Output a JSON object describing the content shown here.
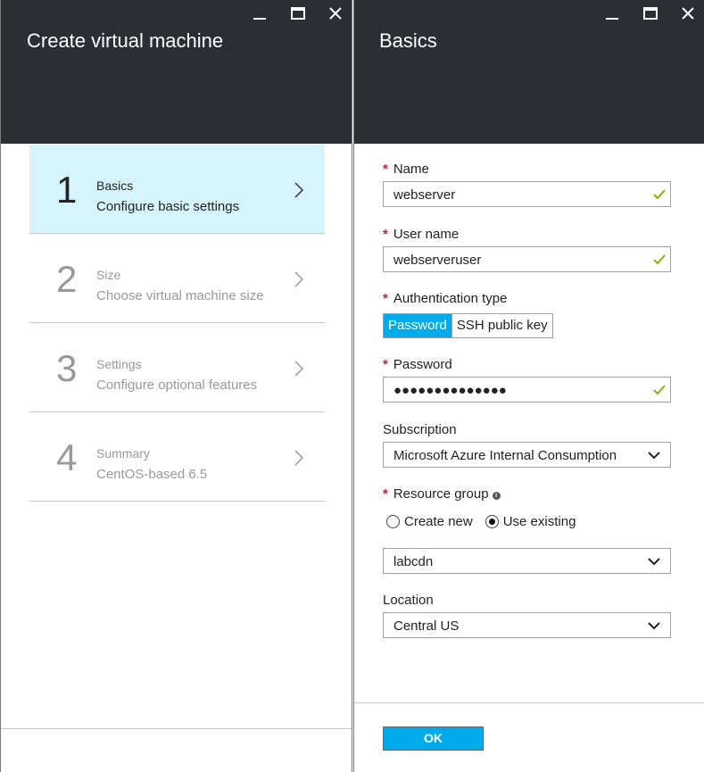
{
  "left_blade": {
    "title": "Create virtual machine",
    "steps": [
      {
        "number": "1",
        "title": "Basics",
        "subtitle": "Configure basic settings",
        "active": true
      },
      {
        "number": "2",
        "title": "Size",
        "subtitle": "Choose virtual machine size",
        "active": false
      },
      {
        "number": "3",
        "title": "Settings",
        "subtitle": "Configure optional features",
        "active": false
      },
      {
        "number": "4",
        "title": "Summary",
        "subtitle": "CentOS-based 6.5",
        "active": false
      }
    ]
  },
  "right_blade": {
    "title": "Basics",
    "required_marker": "*",
    "name": {
      "label": "Name",
      "value": "webserver"
    },
    "user_name": {
      "label": "User name",
      "value": "webserveruser"
    },
    "auth_type": {
      "label": "Authentication type",
      "options": [
        "Password",
        "SSH public key"
      ],
      "selected": "Password"
    },
    "password": {
      "label": "Password",
      "value": "●●●●●●●●●●●●●●"
    },
    "subscription": {
      "label": "Subscription",
      "value": "Microsoft Azure Internal Consumption"
    },
    "resource_group": {
      "label": "Resource group",
      "info_icon": "i",
      "options": [
        "Create new",
        "Use existing"
      ],
      "selected": "Use existing",
      "value": "labcdn"
    },
    "location": {
      "label": "Location",
      "value": "Central US"
    },
    "ok_label": "OK"
  },
  "colors": {
    "header_bg": "#2b2f33",
    "accent": "#00abec",
    "active_step_bg": "#d6f4fb",
    "required": "#c0262d",
    "valid_check": "#7fba00"
  },
  "icons": {
    "window_controls": [
      "minimize-icon",
      "maximize-icon",
      "close-icon"
    ],
    "step_chevron": "chevron-right-icon",
    "valid": "checkmark-icon",
    "dropdown": "chevron-down-icon"
  }
}
